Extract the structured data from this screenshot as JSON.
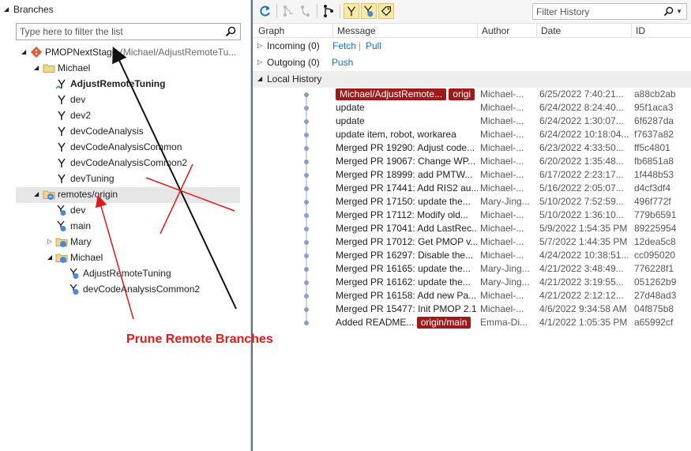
{
  "left": {
    "title": "Branches",
    "filter_placeholder": "Type here to filter the list",
    "repo": {
      "name": "PMOPNextStage",
      "current": "(Michael/AdjustRemoteTu..."
    },
    "local_group": "Michael",
    "local_branches": [
      "AdjustRemoteTuning",
      "dev",
      "dev2",
      "devCodeAnalysis",
      "devCodeAnalysisCommon",
      "devCodeAnalysisCommon2",
      "devTuning"
    ],
    "remotes": "remotes/origin",
    "remote_branches": [
      "dev",
      "main"
    ],
    "remote_group_mary": "Mary",
    "remote_group_michael": "Michael",
    "remote_michael_branches": [
      "AdjustRemoteTuning",
      "devCodeAnalysisCommon2"
    ]
  },
  "right": {
    "filter_placeholder": "Filter History",
    "columns": {
      "graph": "Graph",
      "message": "Message",
      "author": "Author",
      "date": "Date",
      "id": "ID"
    },
    "incoming": {
      "label": "Incoming (0)",
      "fetch": "Fetch",
      "sep": "|",
      "pull": "Pull"
    },
    "outgoing": {
      "label": "Outgoing (0)",
      "push": "Push"
    },
    "local_history": "Local History",
    "rows": [
      {
        "tag1": "Michael/AdjustRemote...",
        "tag2": "origi",
        "author": "Michael-...",
        "date": "6/25/2022 7:40:21...",
        "id": "a88cb2ab"
      },
      {
        "message": "update",
        "author": "Michael-...",
        "date": "6/24/2022 8:24:40...",
        "id": "95f1aca3"
      },
      {
        "message": "update",
        "author": "Michael-...",
        "date": "6/24/2022 1:30:07...",
        "id": "6f6287da"
      },
      {
        "message": "update item, robot, workarea",
        "author": "Michael-...",
        "date": "6/24/2022 10:18:04...",
        "id": "f7637a82"
      },
      {
        "message": "Merged PR 19290: Adjust code...",
        "author": "Michael-...",
        "date": "6/23/2022 4:33:50...",
        "id": "ff5c4801"
      },
      {
        "message": "Merged PR 19067: Change WP...",
        "author": "Michael-...",
        "date": "6/20/2022 1:35:48...",
        "id": "fb6851a8"
      },
      {
        "message": "Merged PR 18999: add PMTW...",
        "author": "Michael-...",
        "date": "6/17/2022 2:23:17...",
        "id": "1f448b53"
      },
      {
        "message": "Merged PR 17441: Add RIS2 au...",
        "author": "Michael-...",
        "date": "5/16/2022 2:05:07...",
        "id": "d4cf3df4"
      },
      {
        "message": "Merged PR 17150: update the...",
        "author": "Mary-Jing...",
        "date": "5/10/2022 7:52:59...",
        "id": "496f772f"
      },
      {
        "message": "Merged PR 17112: Modify old...",
        "author": "Michael-...",
        "date": "5/10/2022 1:36:10...",
        "id": "779b6591"
      },
      {
        "message": "Merged PR 17041: Add LastRec...",
        "author": "Michael-...",
        "date": "5/9/2022 1:54:35 PM",
        "id": "89225954"
      },
      {
        "message": "Merged PR 17012: Get PMOP v...",
        "author": "Michael-...",
        "date": "5/7/2022 1:44:35 PM",
        "id": "12dea5c8"
      },
      {
        "message": "Merged PR 16297: Disable the...",
        "author": "Michael-...",
        "date": "4/24/2022 10:38:51...",
        "id": "cc095020"
      },
      {
        "message": "Merged PR 16165: update the...",
        "author": "Mary-Jing...",
        "date": "4/21/2022 3:48:49...",
        "id": "776228f1"
      },
      {
        "message": "Merged PR 16162: update the...",
        "author": "Mary-Jing...",
        "date": "4/21/2022 3:19:55...",
        "id": "051262b9"
      },
      {
        "message": "Merged PR 16158: Add new Pa...",
        "author": "Michael-...",
        "date": "4/21/2022 2:12:12...",
        "id": "27d48ad3"
      },
      {
        "message": "Merged PR 15477: Init PMOP 2.1",
        "author": "Michael-...",
        "date": "4/6/2022 9:34:58 AM",
        "id": "04f875b8"
      },
      {
        "message": "Added README...",
        "tag": "origin/main",
        "author": "Emma-Di...",
        "date": "4/1/2022 1:05:35 PM",
        "id": "a65992cf"
      }
    ]
  },
  "annotation": "Prune Remote Branches",
  "colors": {
    "tag_bg": "#9c1a1a",
    "link": "#1a6ecf",
    "annotation": "#e01a1a",
    "splitter": "#5b6f8f"
  }
}
